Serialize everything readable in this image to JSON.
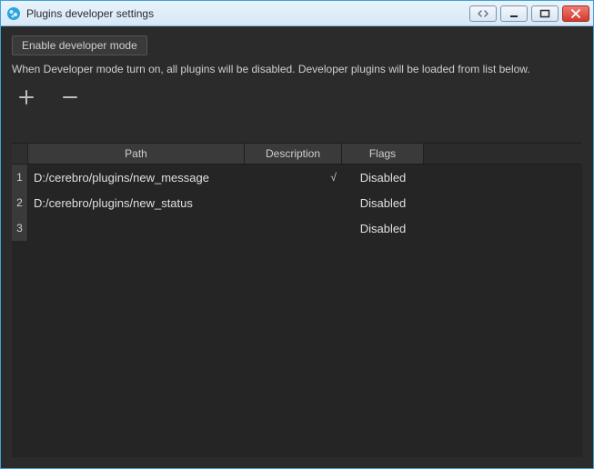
{
  "window": {
    "title": "Plugins developer settings"
  },
  "toolbar": {
    "enable_label": "Enable developer mode"
  },
  "subtext": "When Developer mode turn on, all plugins will be disabled. Developer plugins will be loaded from list below.",
  "table": {
    "headers": {
      "path": "Path",
      "description": "Description",
      "flags": "Flags"
    },
    "rows": [
      {
        "n": "1",
        "path": "D:/cerebro/plugins/new_message",
        "description": "",
        "checked": "√",
        "flags": "Disabled"
      },
      {
        "n": "2",
        "path": "D:/cerebro/plugins/new_status",
        "description": "",
        "checked": "",
        "flags": "Disabled"
      },
      {
        "n": "3",
        "path": "",
        "description": "",
        "checked": "",
        "flags": "Disabled"
      }
    ]
  }
}
